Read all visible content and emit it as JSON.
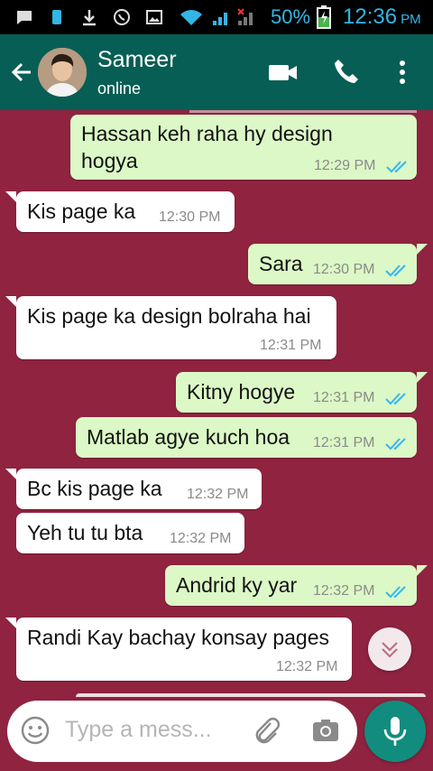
{
  "statusbar": {
    "battery_pct": "50%",
    "time": "12:36",
    "ampm": "PM"
  },
  "header": {
    "contact_name": "Sameer",
    "status": "online"
  },
  "messages": [
    {
      "dir": "out",
      "line1": "Hassan keh raha hy design",
      "line2": "hogya",
      "time": "12:29 PM"
    },
    {
      "dir": "in",
      "text": "Kis page ka",
      "time": "12:30 PM"
    },
    {
      "dir": "out",
      "text": "Sara",
      "time": "12:30 PM"
    },
    {
      "dir": "in",
      "text": "Kis page ka design bolraha hai",
      "time": "12:31 PM"
    },
    {
      "dir": "out",
      "text": "Kitny hogye",
      "time": "12:31 PM"
    },
    {
      "dir": "out",
      "text": "Matlab agye kuch hoa",
      "time": "12:31 PM"
    },
    {
      "dir": "in",
      "text": "Bc kis page ka",
      "time": "12:32 PM"
    },
    {
      "dir": "in",
      "text": "Yeh tu tu bta",
      "time": "12:32 PM"
    },
    {
      "dir": "out",
      "text": "Andrid ky yar",
      "time": "12:32 PM"
    },
    {
      "dir": "in",
      "text": "Randi Kay bachay konsay pages",
      "time": "12:32 PM"
    }
  ],
  "composer": {
    "placeholder": "Type a mess..."
  },
  "colors": {
    "toolbar": "#075e54",
    "background": "#8f2340",
    "out_bubble": "#dcf8c6",
    "in_bubble": "#ffffff",
    "mic": "#128c7e",
    "tick": "#34b7f1"
  }
}
